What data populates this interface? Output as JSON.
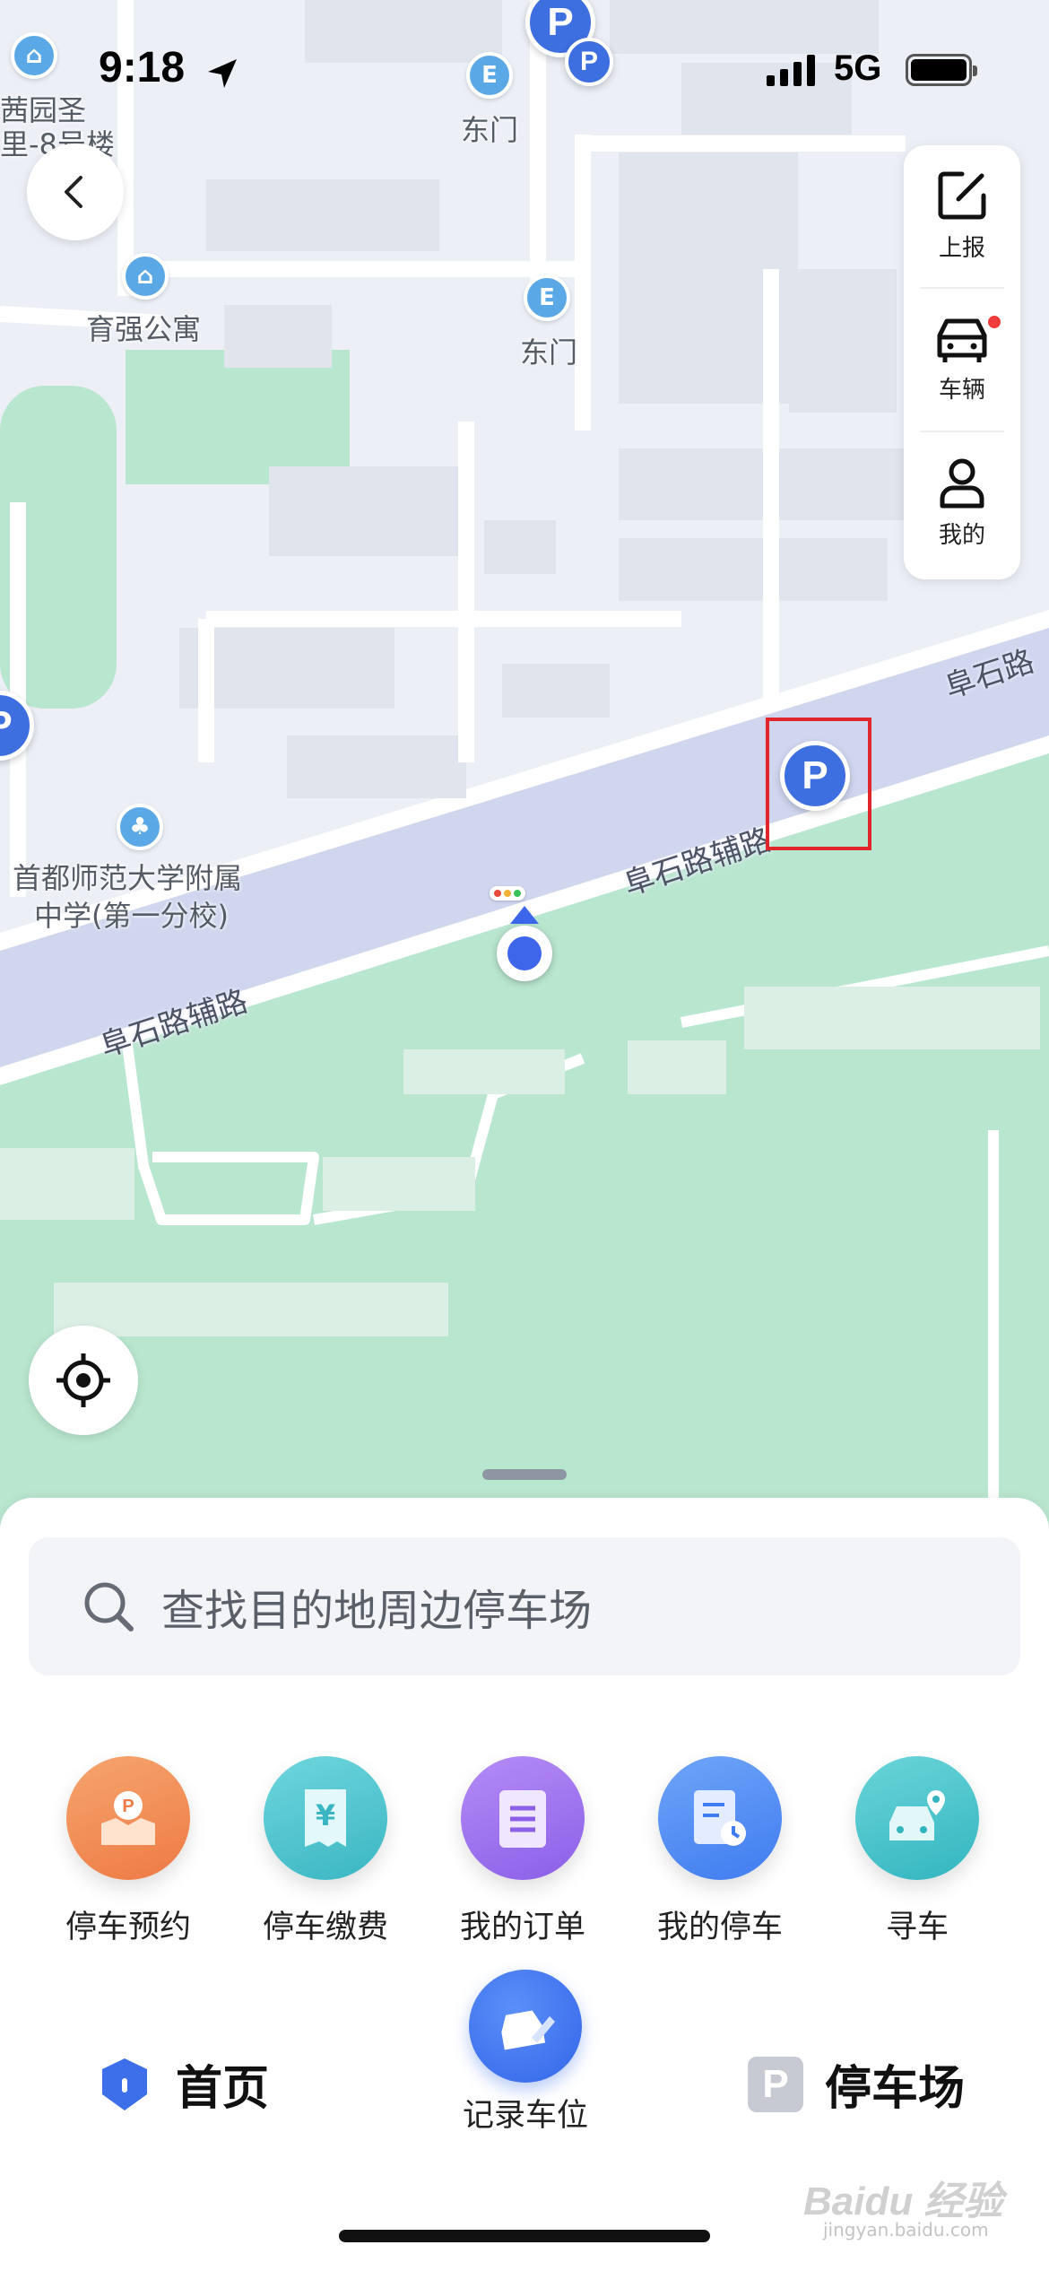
{
  "status_bar": {
    "time": "9:18",
    "network": "5G"
  },
  "map": {
    "labels": {
      "building_top": "茜园圣",
      "building_top2": "里-8号楼",
      "east_gate_1": "东门",
      "east_gate_2": "东门",
      "apartment": "育强公寓",
      "school_line1": "首都师范大学附属",
      "school_line2": "中学(第一分校)"
    },
    "roads": {
      "road_main": "阜石路",
      "road_aux_right": "阜石路辅路",
      "road_aux_left": "阜石路辅路"
    },
    "parking_marker": "P"
  },
  "side_panel": {
    "report": "上报",
    "vehicle": "车辆",
    "mine": "我的"
  },
  "search": {
    "placeholder": "查找目的地周边停车场"
  },
  "actions": [
    {
      "label": "停车预约",
      "color": "#f08a54"
    },
    {
      "label": "停车缴费",
      "color": "#4fc4cf"
    },
    {
      "label": "我的订单",
      "color": "#9b6ff0"
    },
    {
      "label": "我的停车",
      "color": "#4f8ef5"
    },
    {
      "label": "寻车",
      "color": "#45c0cc"
    }
  ],
  "tabbar": {
    "home": "首页",
    "record": "记录车位",
    "parking_lot": "停车场",
    "lot_icon": "P"
  },
  "watermark": {
    "brand": "Baidu 经验",
    "url": "jingyan.baidu.com"
  }
}
